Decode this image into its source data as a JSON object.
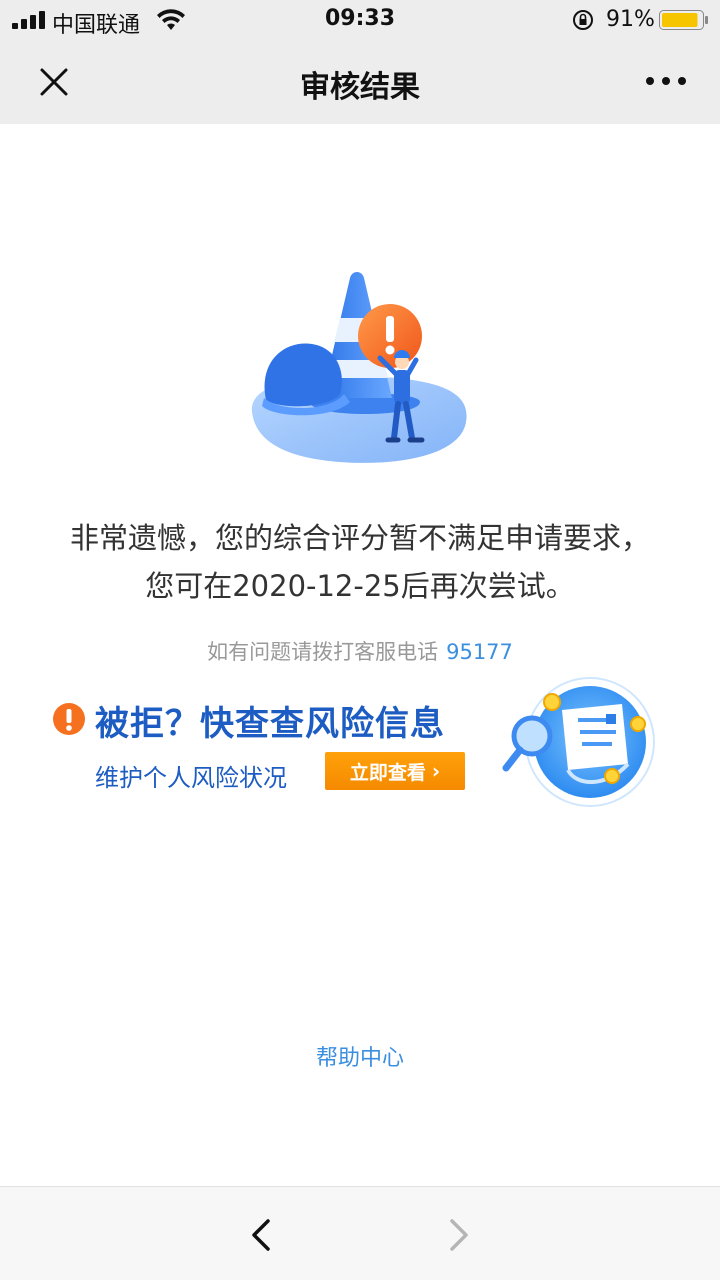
{
  "status_bar": {
    "carrier": "中国联通",
    "time": "09:33",
    "battery_percent": "91%",
    "battery_level": 0.91,
    "icons": [
      "signal-icon",
      "wifi-icon",
      "orientation-lock-icon",
      "battery-icon"
    ]
  },
  "nav": {
    "title": "审核结果",
    "left_icon": "close-icon",
    "right_icon": "more-icon"
  },
  "result": {
    "message": "非常遗憾，您的综合评分暂不满足申请要求，您可在2020-12-25后再次尝试。",
    "service_label": "如有问题请拨打客服电话",
    "service_phone": "95177"
  },
  "risk_banner": {
    "title": "被拒？快查查风险信息",
    "subtitle": "维护个人风险状况",
    "button_label": "立即查看"
  },
  "help_link": "帮助中心",
  "toolbar": {
    "back_icon": "back-arrow-icon",
    "forward_icon": "forward-arrow-icon"
  },
  "colors": {
    "accent_blue": "#3b8fe0",
    "banner_blue": "#1d5cc2",
    "button_orange": "#f7950a",
    "alert_orange": "#f5711f"
  }
}
